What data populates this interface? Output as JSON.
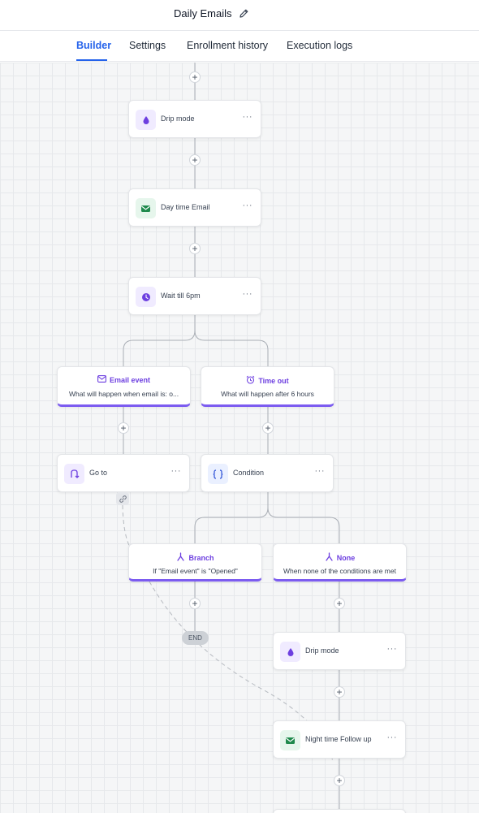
{
  "header": {
    "title": "Daily Emails",
    "edit_icon": "pencil-icon"
  },
  "tabs": [
    {
      "label": "Builder",
      "active": true
    },
    {
      "label": "Settings",
      "active": false
    },
    {
      "label": "Enrollment history",
      "active": false
    },
    {
      "label": "Execution logs",
      "active": false
    }
  ],
  "colors": {
    "accent": "#2563eb",
    "branch_accent": "#7c5cf0",
    "purple_icon": "#6d3fe0",
    "green_icon": "#1f8a4c"
  },
  "workflow": {
    "plus_symbol": "+",
    "more_symbol": "···",
    "nodes": {
      "drip_mode_1": {
        "label": "Drip mode",
        "icon": "drop-icon"
      },
      "day_time_email": {
        "label": "Day time Email",
        "icon": "email-icon"
      },
      "wait": {
        "label": "Wait till 6pm",
        "icon": "clock-icon"
      },
      "goto": {
        "label": "Go to",
        "icon": "goto-icon"
      },
      "condition": {
        "label": "Condition",
        "icon": "braces-icon"
      },
      "drip_mode_2": {
        "label": "Drip mode",
        "icon": "drop-icon"
      },
      "night_follow_up": {
        "label": "Night time Follow up",
        "icon": "email-icon"
      }
    },
    "events": {
      "email_event": {
        "title": "Email event",
        "subtitle": "What will happen when email is: o...",
        "icon": "envelope-icon"
      },
      "time_out": {
        "title": "Time out",
        "subtitle": "What will happen after 6 hours",
        "icon": "alarm-clock-icon"
      },
      "branch": {
        "title": "Branch",
        "subtitle": "If \"Email event\" is \"Opened\"",
        "icon": "branch-icon"
      },
      "none": {
        "title": "None",
        "subtitle": "When none of the conditions are met",
        "icon": "branch-icon"
      }
    },
    "end_label": "END",
    "link_icon": "link-icon"
  }
}
